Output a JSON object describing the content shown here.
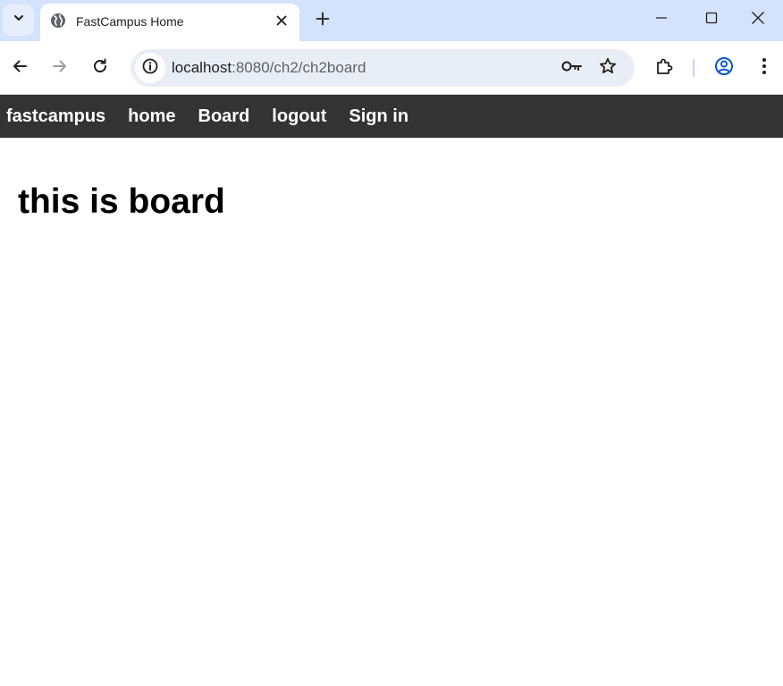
{
  "browser": {
    "tab": {
      "title": "FastCampus Home",
      "favicon": "globe-icon"
    },
    "address_bar": {
      "host": "localhost",
      "path": ":8080/ch2/ch2board"
    },
    "colors": {
      "tabstrip_bg": "#d3e3fd",
      "omnibox_bg": "#e9eef6",
      "profile_accent": "#0b57d0"
    }
  },
  "page": {
    "navbar": {
      "background": "#333333",
      "links": [
        "fastcampus",
        "home",
        "Board",
        "logout",
        "Sign in"
      ]
    },
    "heading": "this is board"
  }
}
